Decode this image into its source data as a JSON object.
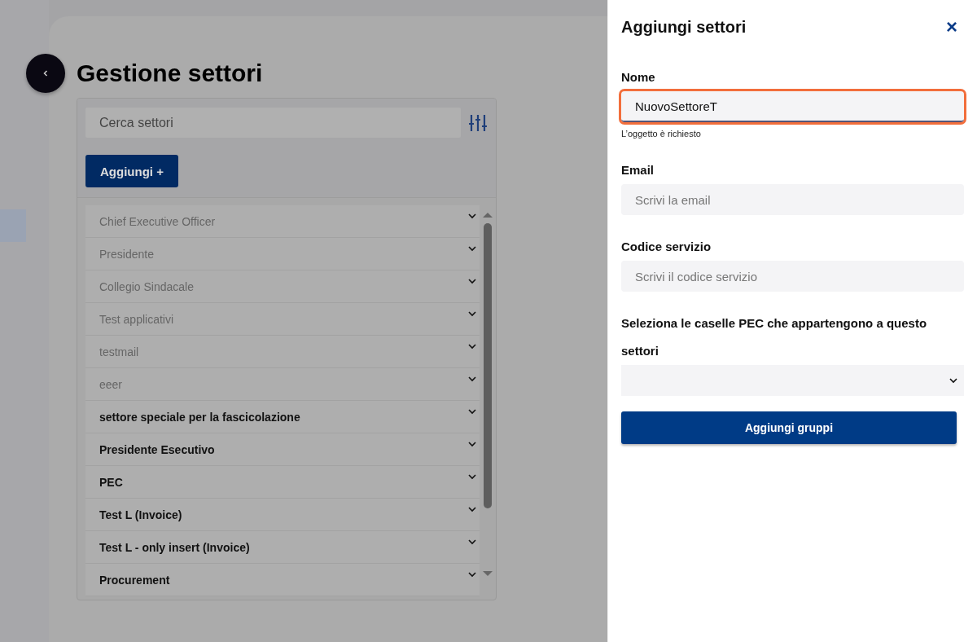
{
  "page": {
    "title": "Gestione settori",
    "search": {
      "placeholder": "Cerca settori"
    },
    "add_button": "Aggiungi +"
  },
  "sectors": [
    {
      "name": "Chief Executive Officer",
      "disabled": true
    },
    {
      "name": "Presidente",
      "disabled": true
    },
    {
      "name": "Collegio Sindacale",
      "disabled": true
    },
    {
      "name": "Test applicativi",
      "disabled": true
    },
    {
      "name": "testmail",
      "disabled": true
    },
    {
      "name": "eeer",
      "disabled": true
    },
    {
      "name": "settore speciale per la fascicolazione",
      "disabled": false
    },
    {
      "name": "Presidente Esecutivo",
      "disabled": false
    },
    {
      "name": "PEC",
      "disabled": false
    },
    {
      "name": "Test L (Invoice)",
      "disabled": false
    },
    {
      "name": "Test L - only insert (Invoice)",
      "disabled": false
    },
    {
      "name": "Procurement",
      "disabled": false
    }
  ],
  "drawer": {
    "title": "Aggiungi settori",
    "close": "×",
    "fields": [
      {
        "kind": "input",
        "label": "Nome",
        "value": "NuovoSettoreT",
        "error": true,
        "helper": "L’oggetto è richiesto"
      },
      {
        "kind": "input",
        "label": "Email",
        "placeholder": "Scrivi la email",
        "error": false
      },
      {
        "kind": "input",
        "label": "Codice servizio",
        "placeholder": "Scrivi il codice servizio",
        "error": false
      },
      {
        "kind": "select",
        "label": "Seleziona le caselle PEC che appartengono a questo settori",
        "error": false
      }
    ],
    "submit": "Aggiungi gruppi"
  }
}
